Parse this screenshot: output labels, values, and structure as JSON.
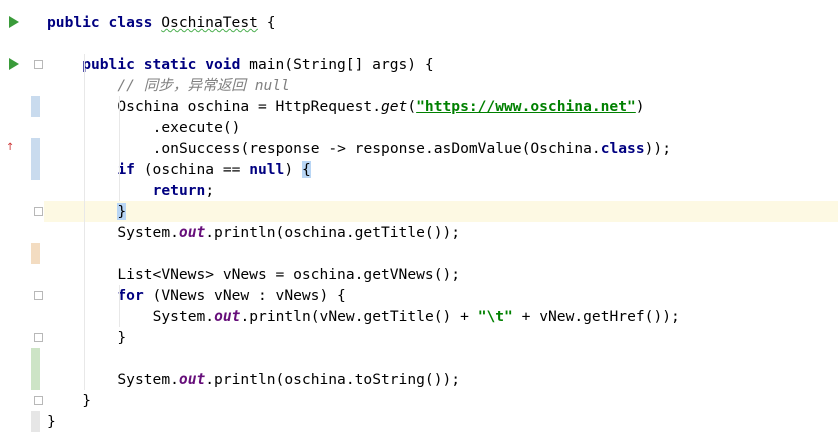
{
  "editor": {
    "language": "java",
    "caret_line": 10,
    "lines": [
      {
        "n": 1,
        "indent": 0,
        "tokens": [
          {
            "t": "public",
            "c": "kw"
          },
          {
            "t": " "
          },
          {
            "t": "class",
            "c": "kw"
          },
          {
            "t": " "
          },
          {
            "t": "OschinaTest",
            "c": "typo"
          },
          {
            "t": " {"
          }
        ]
      },
      {
        "n": 2,
        "indent": 0,
        "tokens": []
      },
      {
        "n": 3,
        "indent": 1,
        "tokens": [
          {
            "t": "public",
            "c": "kw"
          },
          {
            "t": " "
          },
          {
            "t": "static",
            "c": "kw"
          },
          {
            "t": " "
          },
          {
            "t": "void",
            "c": "kw"
          },
          {
            "t": " main(String[] args) {"
          }
        ]
      },
      {
        "n": 4,
        "indent": 2,
        "tokens": [
          {
            "t": "// 同步，异常返回 null",
            "c": "cm"
          }
        ]
      },
      {
        "n": 5,
        "indent": 2,
        "tokens": [
          {
            "t": "Oschina oschina = HttpRequest."
          },
          {
            "t": "get",
            "c": "ital"
          },
          {
            "t": "("
          },
          {
            "t": "\"https://www.oschina.net\"",
            "c": "url"
          },
          {
            "t": ")"
          }
        ]
      },
      {
        "n": 6,
        "indent": 3,
        "tokens": [
          {
            "t": ".execute()"
          }
        ]
      },
      {
        "n": 7,
        "indent": 3,
        "tokens": [
          {
            "t": ".onSuccess(response -> response.asDomValue(Oschina."
          },
          {
            "t": "class",
            "c": "kw"
          },
          {
            "t": "));"
          }
        ]
      },
      {
        "n": 8,
        "indent": 2,
        "tokens": [
          {
            "t": "if",
            "c": "kw"
          },
          {
            "t": " (oschina == "
          },
          {
            "t": "null",
            "c": "kw"
          },
          {
            "t": ") "
          },
          {
            "t": "{",
            "c": "brace-hl"
          }
        ]
      },
      {
        "n": 9,
        "indent": 3,
        "tokens": [
          {
            "t": "return",
            "c": "kw"
          },
          {
            "t": ";"
          }
        ]
      },
      {
        "n": 10,
        "indent": 2,
        "tokens": [
          {
            "t": "}",
            "c": "brace-hl"
          }
        ]
      },
      {
        "n": 11,
        "indent": 2,
        "tokens": [
          {
            "t": "System."
          },
          {
            "t": "out",
            "c": "it"
          },
          {
            "t": ".println(oschina.getTitle());"
          }
        ]
      },
      {
        "n": 12,
        "indent": 0,
        "tokens": []
      },
      {
        "n": 13,
        "indent": 2,
        "tokens": [
          {
            "t": "List<VNews> vNews = oschina.getVNews();"
          }
        ]
      },
      {
        "n": 14,
        "indent": 2,
        "tokens": [
          {
            "t": "for",
            "c": "kw"
          },
          {
            "t": " (VNews vNew : vNews) {"
          }
        ]
      },
      {
        "n": 15,
        "indent": 3,
        "tokens": [
          {
            "t": "System."
          },
          {
            "t": "out",
            "c": "it"
          },
          {
            "t": ".println(vNew.getTitle() + "
          },
          {
            "t": "\"\\t\"",
            "c": "str"
          },
          {
            "t": " + vNew.getHref());"
          }
        ]
      },
      {
        "n": 16,
        "indent": 2,
        "tokens": [
          {
            "t": "}"
          }
        ]
      },
      {
        "n": 17,
        "indent": 0,
        "tokens": []
      },
      {
        "n": 18,
        "indent": 2,
        "tokens": [
          {
            "t": "System."
          },
          {
            "t": "out",
            "c": "it"
          },
          {
            "t": ".println(oschina.toString());"
          }
        ]
      },
      {
        "n": 19,
        "indent": 1,
        "tokens": [
          {
            "t": "}"
          }
        ]
      },
      {
        "n": 20,
        "indent": 0,
        "tokens": [
          {
            "t": "}"
          }
        ]
      }
    ]
  },
  "gutter": {
    "run_icon_lines": [
      1,
      3
    ],
    "fold_lines": [
      3,
      10,
      14,
      16,
      19
    ],
    "override_icon": {
      "line": 7,
      "label": "↑"
    },
    "change_marks": [
      {
        "from": 5,
        "to": 5,
        "color": "#c9dbee"
      },
      {
        "from": 7,
        "to": 8,
        "color": "#c9dbee"
      },
      {
        "from": 12,
        "to": 12,
        "color": "#f3dcc1"
      },
      {
        "from": 17,
        "to": 18,
        "color": "#cde4c6"
      },
      {
        "from": 20,
        "to": 20,
        "color": "#e6e6e6"
      }
    ]
  },
  "colors": {
    "keyword": "#000080",
    "string": "#008000",
    "comment": "#808080",
    "static_field": "#660e7a",
    "caret_line": "#fdf9e3"
  }
}
